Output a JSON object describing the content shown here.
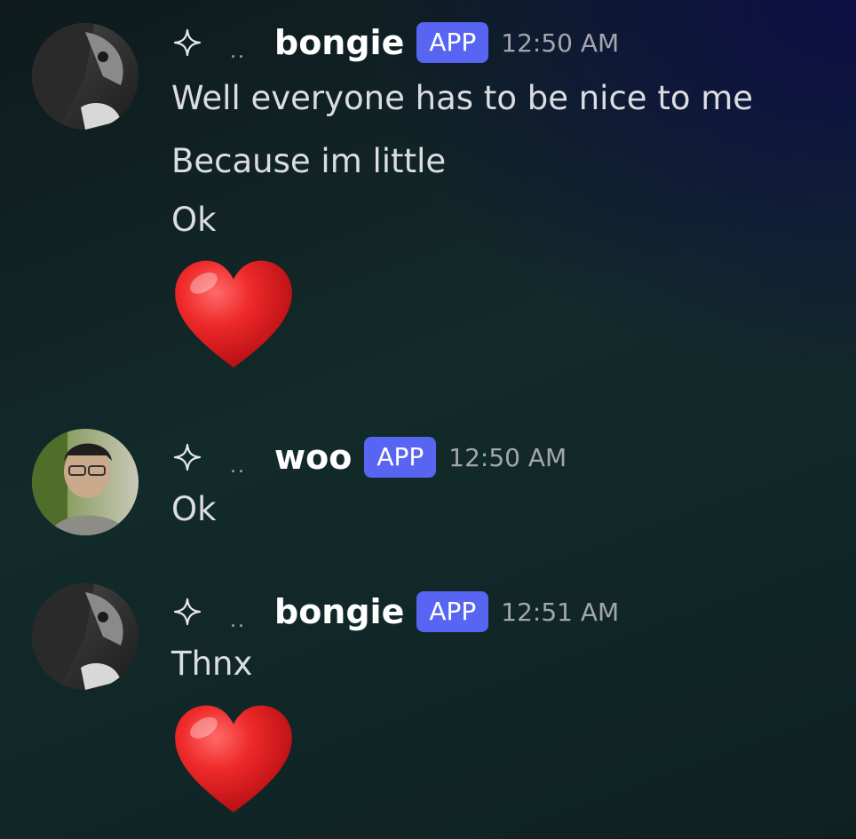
{
  "messages": [
    {
      "username": "bongie",
      "badge": "APP",
      "timestamp": "12:50 AM",
      "prefix_dots": "..",
      "lines": [
        "Well everyone has to be nice to me",
        "Because im little",
        "Ok"
      ],
      "emoji": "heart-icon"
    },
    {
      "username": "woo",
      "badge": "APP",
      "timestamp": "12:50 AM",
      "prefix_dots": "..",
      "lines": [
        "Ok"
      ]
    },
    {
      "username": "bongie",
      "badge": "APP",
      "timestamp": "12:51 AM",
      "prefix_dots": "..",
      "lines": [
        "Thnx"
      ],
      "emoji": "heart-icon"
    }
  ],
  "colors": {
    "badge": "#5865f2",
    "username": "#ffffff",
    "timestamp": "#a3a6ac",
    "message_text": "#dcdde0",
    "heart": "#e0192e"
  }
}
